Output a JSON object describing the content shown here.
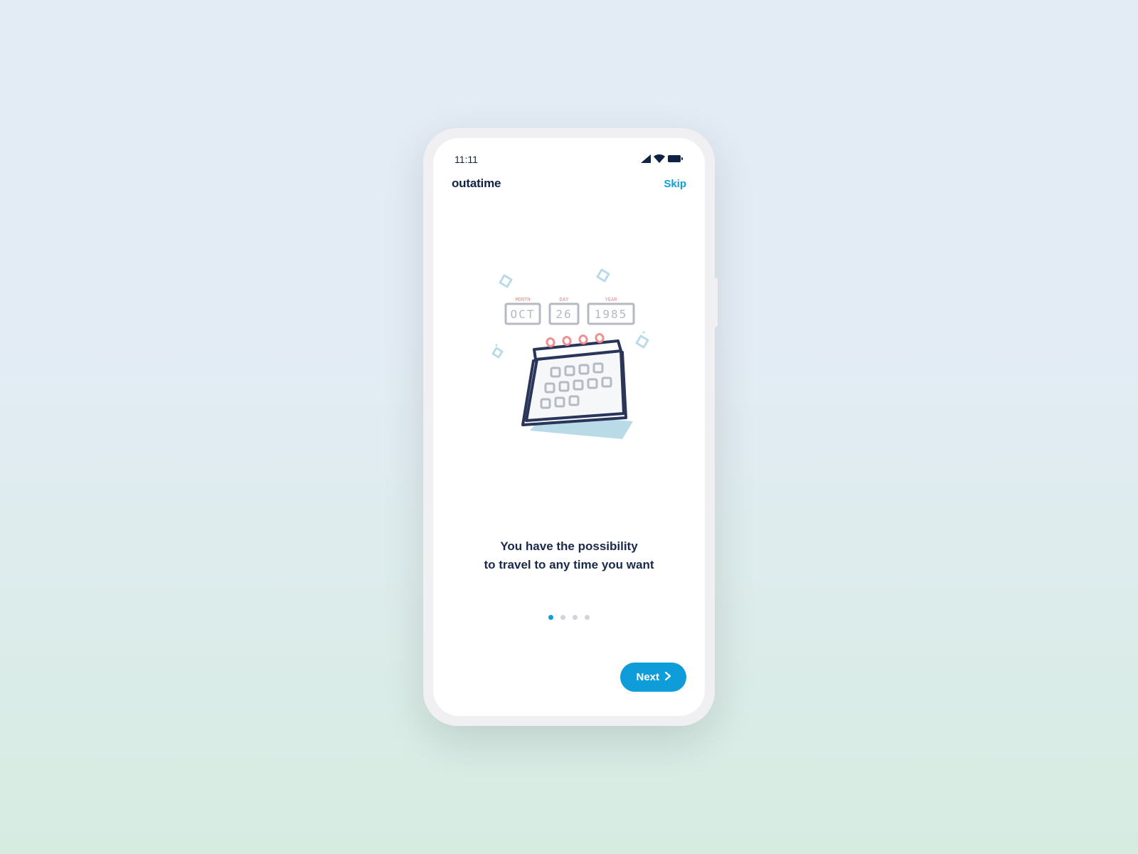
{
  "statusBar": {
    "time": "11:11"
  },
  "header": {
    "appName": "outatime",
    "skip": "Skip"
  },
  "illustration": {
    "labels": {
      "month": "MONTH",
      "day": "DAY",
      "year": "YEAR"
    },
    "values": {
      "month": "OCT",
      "day": "26",
      "year": "1985"
    }
  },
  "caption": {
    "line1": "You have the possibility",
    "line2": "to travel to any time you want"
  },
  "pagination": {
    "count": 4,
    "activeIndex": 0
  },
  "footer": {
    "next": "Next"
  },
  "colors": {
    "accent": "#0e9dd9",
    "text": "#1a2a4a"
  }
}
